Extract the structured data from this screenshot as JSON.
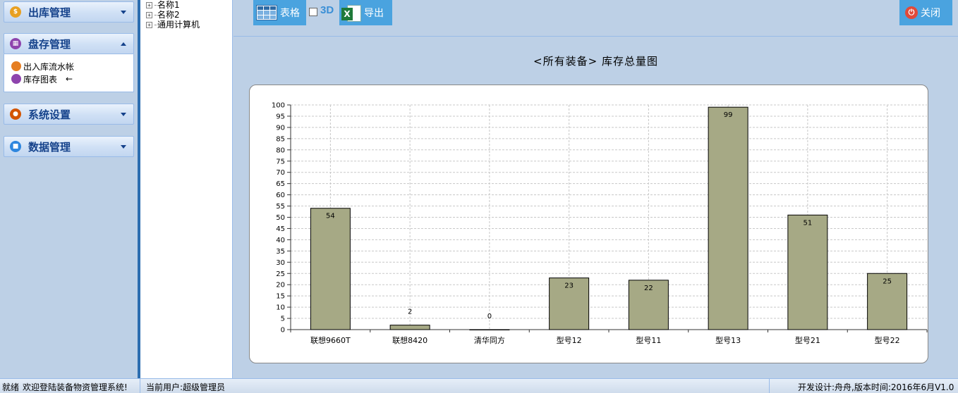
{
  "sidebar": {
    "sections": [
      {
        "title": "出库管理",
        "icon": "coin-icon",
        "expanded": false
      },
      {
        "title": "盘存管理",
        "icon": "inventory-icon",
        "expanded": true,
        "items": [
          {
            "label": "出入库流水帐",
            "icon": "ledger-icon"
          },
          {
            "label": "库存图表",
            "icon": "chart-icon",
            "marker": "←"
          }
        ]
      },
      {
        "title": "系统设置",
        "icon": "users-icon",
        "expanded": false
      },
      {
        "title": "数据管理",
        "icon": "database-icon",
        "expanded": false
      }
    ]
  },
  "tree": {
    "nodes": [
      {
        "label": "名称1",
        "expander": "+"
      },
      {
        "label": "名称2",
        "expander": "+"
      },
      {
        "label": "通用计算机",
        "expander": "+"
      }
    ]
  },
  "toolbar": {
    "table_label": "表格",
    "label_3d": "3D",
    "export_label": "导出",
    "close_label": "关闭"
  },
  "chart_title": "<所有装备>  库存总量图",
  "chart_data": {
    "type": "bar",
    "categories": [
      "联想9660T",
      "联想8420",
      "清华同方",
      "型号12",
      "型号11",
      "型号13",
      "型号21",
      "型号22"
    ],
    "values": [
      54,
      2,
      0,
      23,
      22,
      99,
      51,
      25
    ],
    "ylim": [
      0,
      100
    ],
    "yticks": [
      0,
      5,
      10,
      15,
      20,
      25,
      30,
      35,
      40,
      45,
      50,
      55,
      60,
      65,
      70,
      75,
      80,
      85,
      90,
      95,
      100
    ],
    "grid": true,
    "bar_color": "#a6a985",
    "data_labels": true
  },
  "status": {
    "state": "就绪",
    "welcome": "欢迎登陆装备物资管理系统!",
    "user": "当前用户:超级管理员",
    "dev": "开发设计:舟舟,版本时间:2016年6月V1.0"
  },
  "colors": {
    "accent": "#4aa3df",
    "header_text": "#15428b",
    "split_bar": "#2c6db0"
  }
}
